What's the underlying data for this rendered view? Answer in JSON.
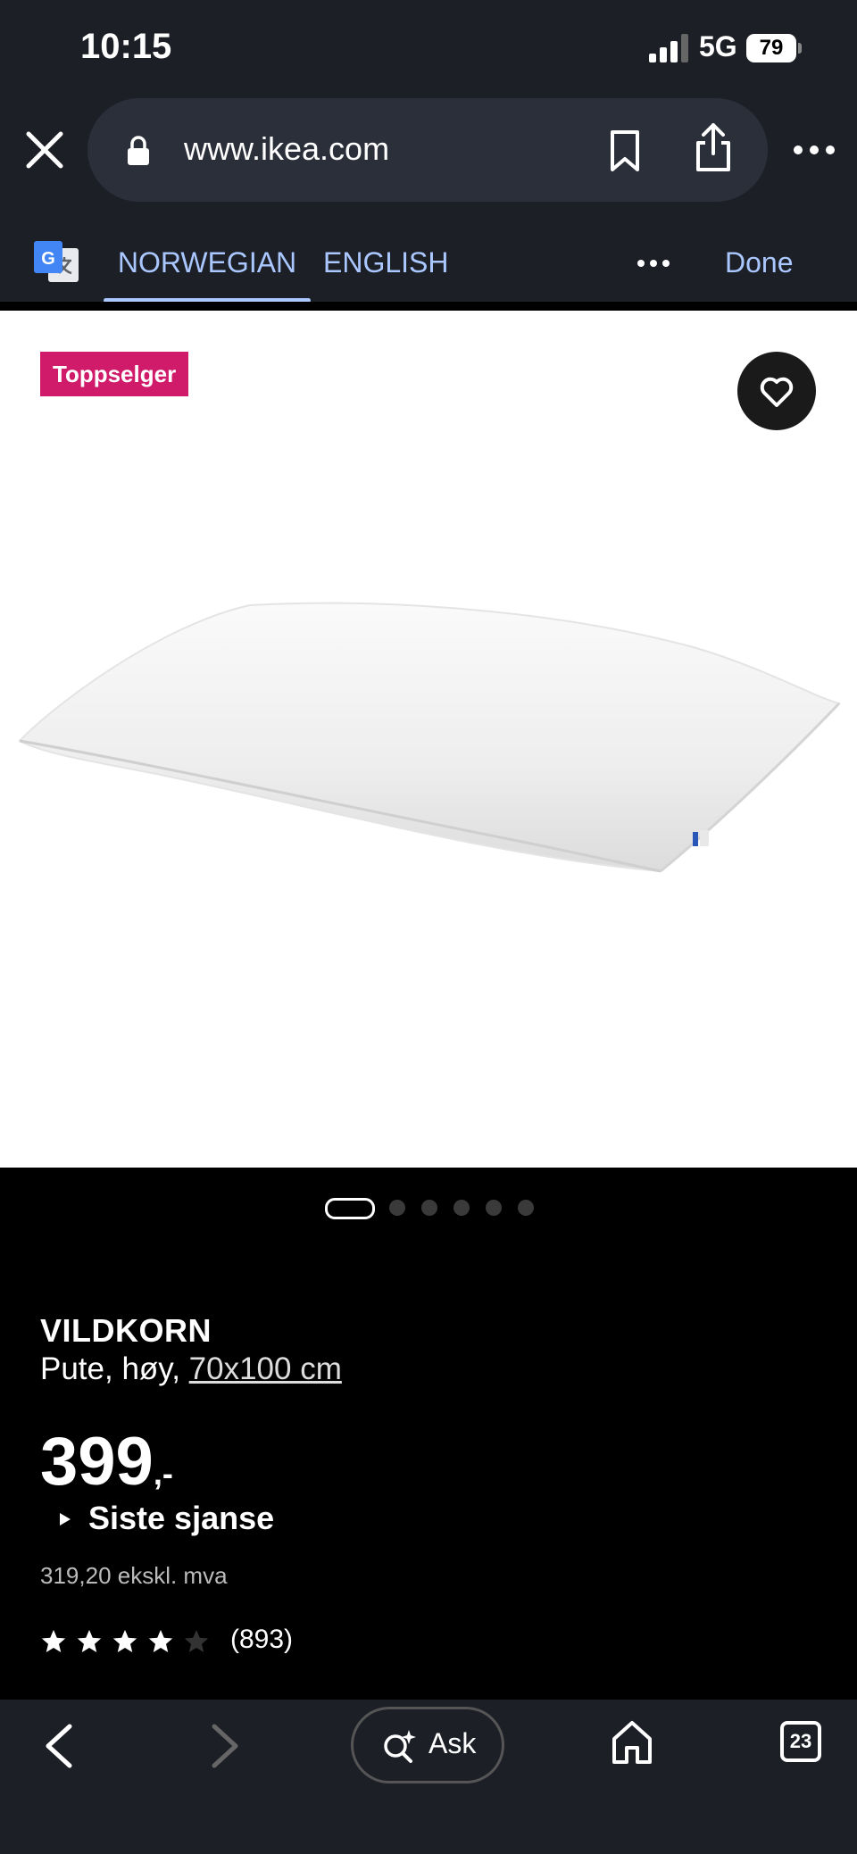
{
  "status_bar": {
    "time": "10:15",
    "network": "5G",
    "battery": "79"
  },
  "browser": {
    "url": "www.ikea.com",
    "icons": [
      "close-icon",
      "lock-icon",
      "bookmark-icon",
      "share-icon",
      "more-icon"
    ]
  },
  "translate_bar": {
    "tabs": [
      {
        "label": "NORWEGIAN",
        "active": true
      },
      {
        "label": "ENGLISH",
        "active": false
      }
    ],
    "done_label": "Done",
    "icons": [
      "google-translate-icon",
      "more-icon"
    ]
  },
  "product": {
    "badge": "Toppselger",
    "name": "VILDKORN",
    "description_prefix": "Pute, høy, ",
    "size": "70x100 cm",
    "price": "399",
    "price_suffix": ",-",
    "price_note": "Siste sjanse",
    "excl_vat": "319,20 ekskl. mva",
    "rating": 4,
    "rating_max": 5,
    "review_count": "(893)",
    "carousel": {
      "count": 6,
      "active_index": 0
    }
  },
  "bottom_bar": {
    "ask_label": "Ask",
    "tab_count": "23",
    "icons": [
      "back-icon",
      "forward-icon",
      "ask-icon",
      "home-icon",
      "tabs-icon"
    ]
  },
  "colors": {
    "chrome_bg": "#1c1f26",
    "accent_blue": "#aac7ff",
    "badge_pink": "#d01a6a",
    "page_bg": "#000000"
  }
}
